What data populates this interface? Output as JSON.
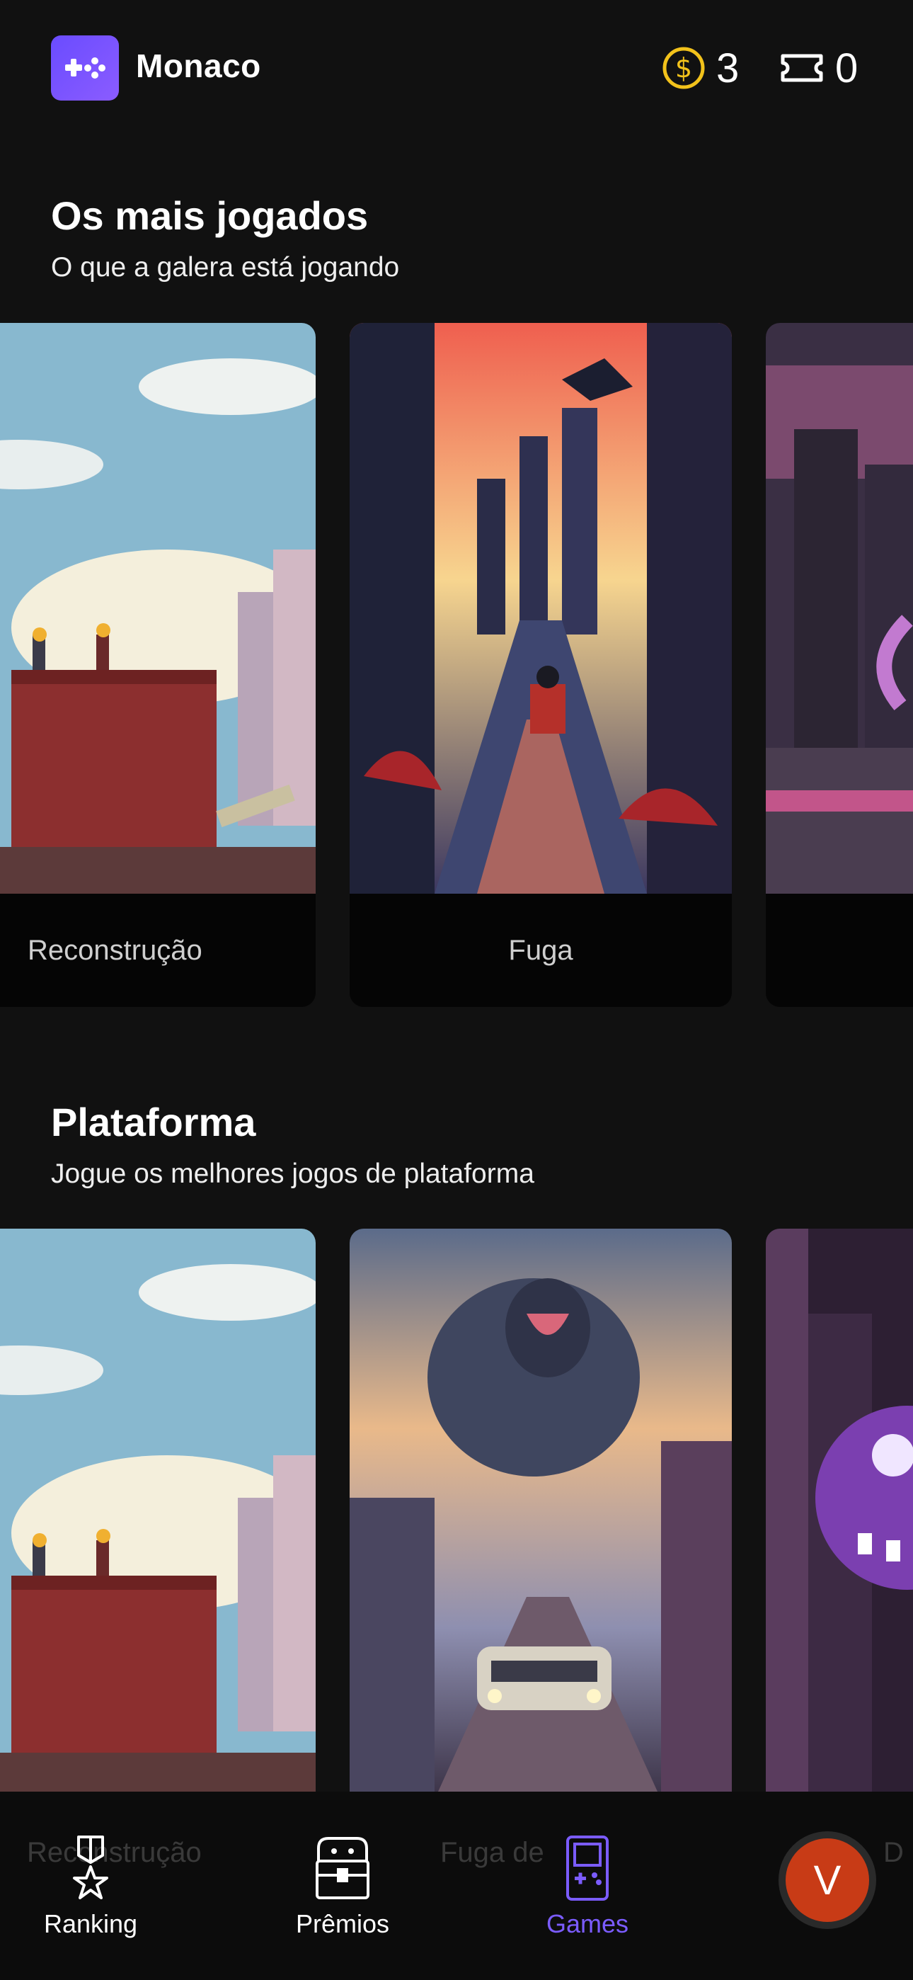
{
  "header": {
    "app_name": "Monaco",
    "coins": "3",
    "tickets": "0"
  },
  "sections": [
    {
      "title": "Os mais jogados",
      "subtitle": "O que a galera está jogando",
      "cards": [
        {
          "label": "Reconstrução"
        },
        {
          "label": "Fuga"
        },
        {
          "label": ""
        }
      ]
    },
    {
      "title": "Plataforma",
      "subtitle": "Jogue os melhores jogos de plataforma",
      "cards": [
        {
          "label": "Reconstrução"
        },
        {
          "label": "Fuga de ..."
        },
        {
          "label": ""
        }
      ]
    }
  ],
  "nav": {
    "items": [
      {
        "label": "Ranking",
        "icon": "medal-icon"
      },
      {
        "label": "Prêmios",
        "icon": "treasure-chest-icon"
      },
      {
        "label": "Games",
        "icon": "gameboy-icon"
      }
    ],
    "avatar_letter": "V",
    "ghost": {
      "a": "Reconstrução",
      "b": "Fuga de",
      "c": "D"
    }
  },
  "colors": {
    "accent": "#7b5cff",
    "background": "#111111",
    "coin": "#f2c21b",
    "avatar": "#c83b16"
  }
}
